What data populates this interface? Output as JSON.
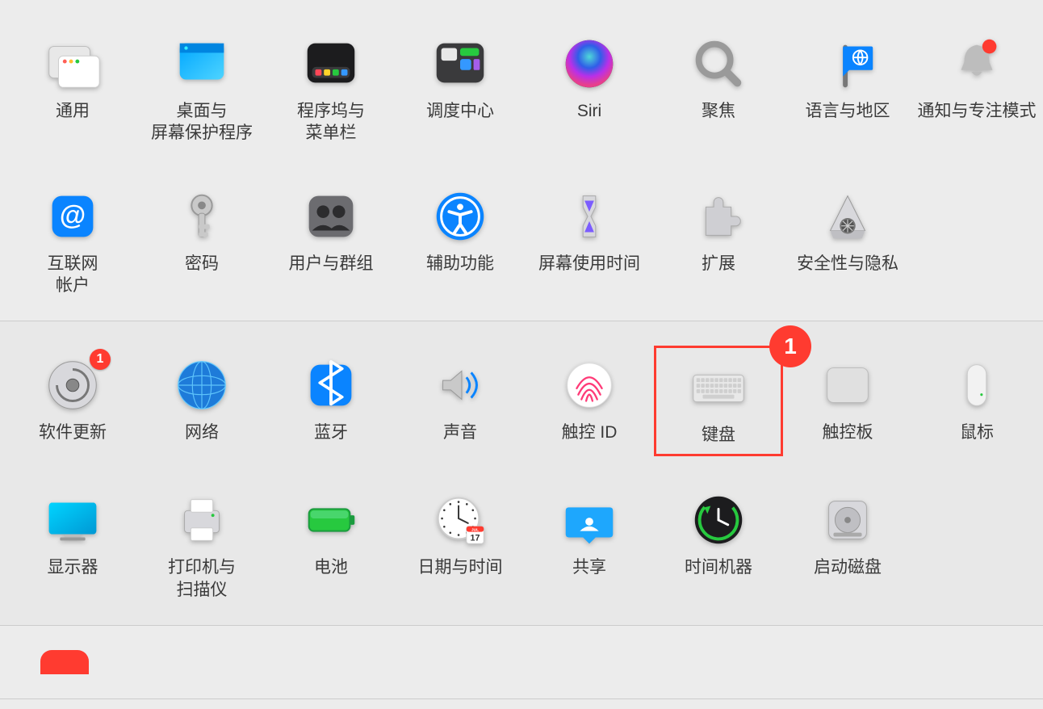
{
  "sections": [
    {
      "rows": [
        {
          "id": "general",
          "label": "通用"
        },
        {
          "id": "desktop",
          "label": "桌面与\n屏幕保护程序"
        },
        {
          "id": "dock",
          "label": "程序坞与\n菜单栏"
        },
        {
          "id": "mission",
          "label": "调度中心"
        },
        {
          "id": "siri",
          "label": "Siri"
        },
        {
          "id": "spotlight",
          "label": "聚焦"
        },
        {
          "id": "language",
          "label": "语言与地区"
        },
        {
          "id": "notifications",
          "label": "通知与专注模式"
        },
        {
          "id": "internet",
          "label": "互联网\n帐户"
        },
        {
          "id": "passwords",
          "label": "密码"
        },
        {
          "id": "users",
          "label": "用户与群组"
        },
        {
          "id": "accessibility",
          "label": "辅助功能"
        },
        {
          "id": "screentime",
          "label": "屏幕使用时间"
        },
        {
          "id": "extensions",
          "label": "扩展"
        },
        {
          "id": "security",
          "label": "安全性与隐私"
        }
      ]
    },
    {
      "rows": [
        {
          "id": "update",
          "label": "软件更新",
          "badge": "1"
        },
        {
          "id": "network",
          "label": "网络"
        },
        {
          "id": "bluetooth",
          "label": "蓝牙"
        },
        {
          "id": "sound",
          "label": "声音"
        },
        {
          "id": "touchid",
          "label": "触控 ID"
        },
        {
          "id": "keyboard",
          "label": "键盘",
          "highlight": true,
          "callout": "1"
        },
        {
          "id": "trackpad",
          "label": "触控板"
        },
        {
          "id": "mouse",
          "label": "鼠标"
        },
        {
          "id": "displays",
          "label": "显示器"
        },
        {
          "id": "printers",
          "label": "打印机与\n扫描仪"
        },
        {
          "id": "battery",
          "label": "电池"
        },
        {
          "id": "datetime",
          "label": "日期与时间"
        },
        {
          "id": "sharing",
          "label": "共享"
        },
        {
          "id": "timemachine",
          "label": "时间机器"
        },
        {
          "id": "startup",
          "label": "启动磁盘"
        }
      ]
    }
  ]
}
